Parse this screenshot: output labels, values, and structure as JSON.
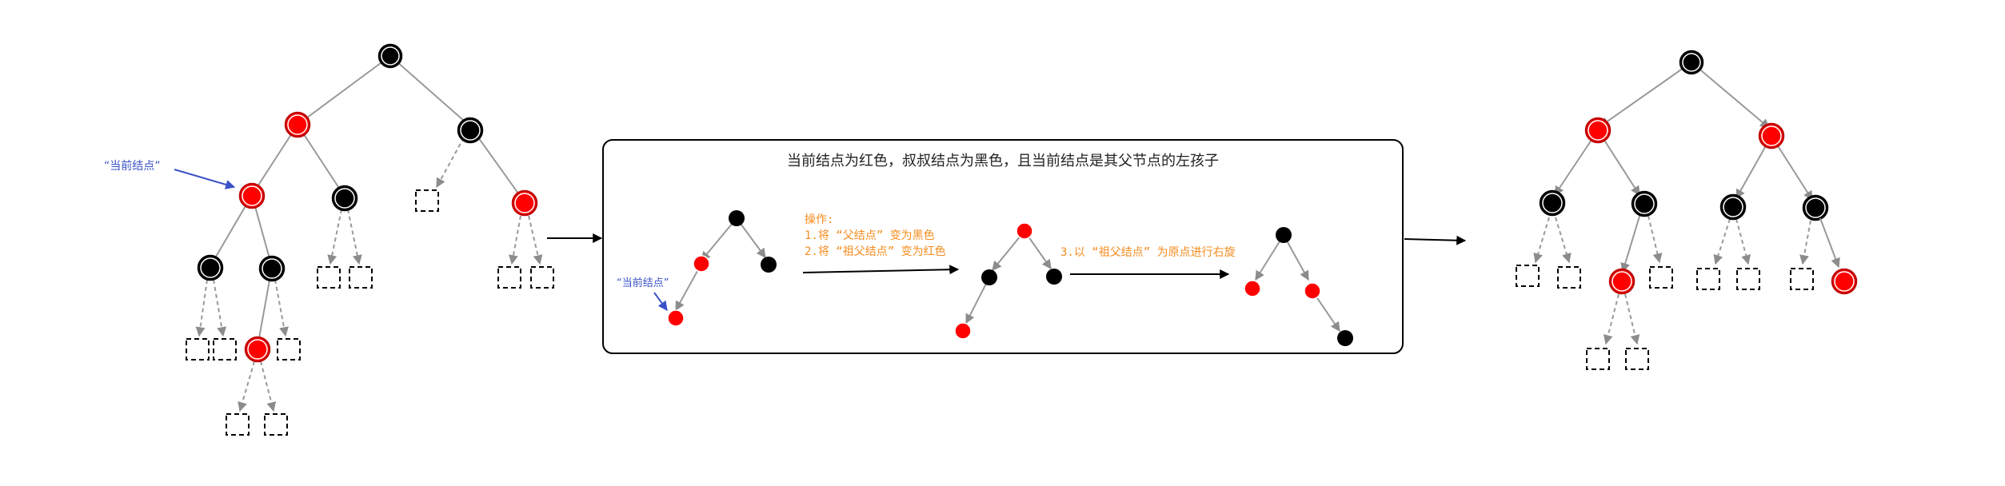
{
  "colors": {
    "red": "#ff0000",
    "black": "#000000",
    "edge": "#999999",
    "note_blue": "#3a52c8",
    "op_orange": "#f58c1e"
  },
  "left_tree": {
    "current_node_label": "“当前结点”"
  },
  "middle_panel": {
    "title": "当前结点为红色，叔叔结点为黑色，且当前结点是其父节点的左孩子",
    "current_node_label": "“当前结点”",
    "operations": [
      "操作:",
      "1.将 “父结点” 变为黑色",
      "2.将 “祖父结点” 变为红色"
    ],
    "rotate_step": "3.以 “祖父结点” 为原点进行右旋"
  },
  "icons": {
    "arrow": "right-arrow-icon"
  }
}
